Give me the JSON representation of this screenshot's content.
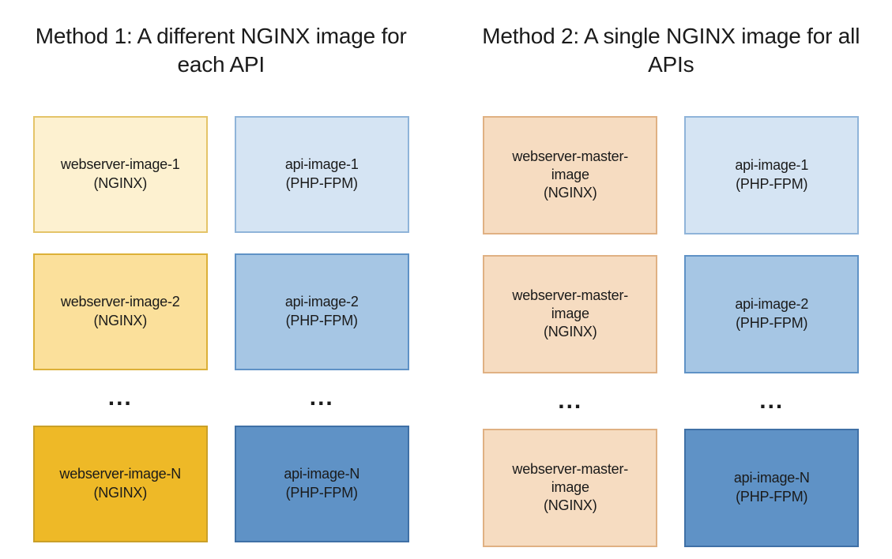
{
  "methods": [
    {
      "title": "Method 1: A different NGINX image for each API",
      "rows": [
        {
          "left": {
            "line1": "webserver-image-1",
            "line2": "(NGINX)",
            "bg": "#fdf1d0",
            "border": "#e4c469"
          },
          "right": {
            "line1": "api-image-1",
            "line2": "(PHP-FPM)",
            "bg": "#d5e4f3",
            "border": "#8fb4d9"
          }
        },
        {
          "left": {
            "line1": "webserver-image-2",
            "line2": "(NGINX)",
            "bg": "#fbe09b",
            "border": "#dcb038"
          },
          "right": {
            "line1": "api-image-2",
            "line2": "(PHP-FPM)",
            "bg": "#a6c6e4",
            "border": "#5f92c6"
          }
        },
        {
          "dots": "..."
        },
        {
          "left": {
            "line1": "webserver-image-N",
            "line2": "(NGINX)",
            "bg": "#eeb927",
            "border": "#caa028"
          },
          "right": {
            "line1": "api-image-N",
            "line2": "(PHP-FPM)",
            "bg": "#5f92c6",
            "border": "#3f70a6"
          }
        }
      ]
    },
    {
      "title": "Method 2: A single NGINX image for all APIs",
      "rows": [
        {
          "left": {
            "line1": "webserver-master-",
            "line2": "image",
            "line3": "(NGINX)",
            "bg": "#f6dcc1",
            "border": "#e0b183"
          },
          "right": {
            "line1": "api-image-1",
            "line2": "(PHP-FPM)",
            "bg": "#d5e4f3",
            "border": "#8fb4d9"
          }
        },
        {
          "left": {
            "line1": "webserver-master-",
            "line2": "image",
            "line3": "(NGINX)",
            "bg": "#f6dcc1",
            "border": "#e0b183"
          },
          "right": {
            "line1": "api-image-2",
            "line2": "(PHP-FPM)",
            "bg": "#a6c6e4",
            "border": "#5f92c6"
          }
        },
        {
          "dots": "..."
        },
        {
          "left": {
            "line1": "webserver-master-",
            "line2": "image",
            "line3": "(NGINX)",
            "bg": "#f6dcc1",
            "border": "#e0b183"
          },
          "right": {
            "line1": "api-image-N",
            "line2": "(PHP-FPM)",
            "bg": "#5f92c6",
            "border": "#3f70a6"
          }
        }
      ]
    }
  ]
}
